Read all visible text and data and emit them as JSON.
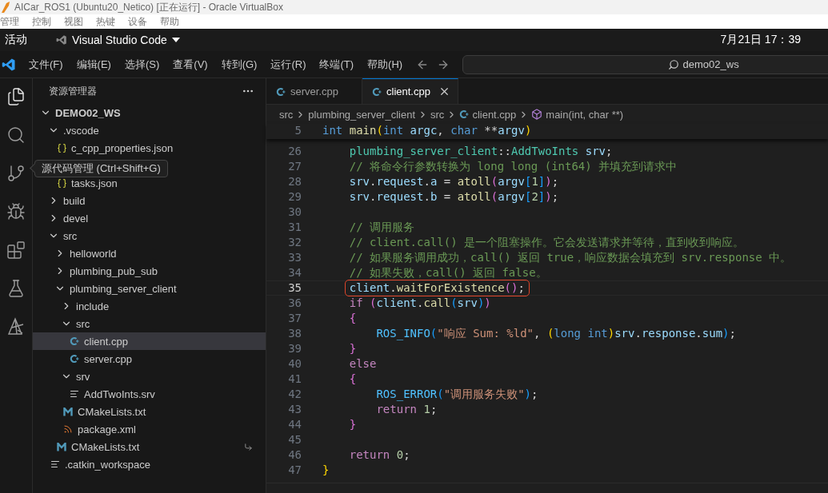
{
  "vbox": {
    "title": "AICar_ROS1 (Ubuntu20_Netico) [正在运行] - Oracle VirtualBox",
    "menu": [
      "管理",
      "控制",
      "视图",
      "热键",
      "设备",
      "帮助"
    ]
  },
  "top_bar": {
    "activities": "活动",
    "app": "Visual Studio Code",
    "clock": "7月21日 17：39"
  },
  "menu": [
    "文件(F)",
    "编辑(E)",
    "选择(S)",
    "查看(V)",
    "转到(G)",
    "运行(R)",
    "终端(T)",
    "帮助(H)"
  ],
  "command_center": {
    "text": "demo02_ws"
  },
  "activity_bar": [
    {
      "kind": "explorer",
      "selected": true
    },
    {
      "kind": "search",
      "selected": false
    },
    {
      "kind": "source-control",
      "selected": false
    },
    {
      "kind": "run-debug",
      "selected": false
    },
    {
      "kind": "extensions",
      "selected": false
    },
    {
      "kind": "testing",
      "selected": false
    },
    {
      "kind": "ros",
      "selected": false
    }
  ],
  "tooltip": {
    "text": "源代码管理 (Ctrl+Shift+G)"
  },
  "sidebar": {
    "title": "资源管理器",
    "root": {
      "name": "DEMO02_WS",
      "expanded": true,
      "children": [
        {
          "name": ".vscode",
          "kind": "folder",
          "expanded": true,
          "selected": false,
          "children": [
            {
              "name": "c_cpp_properties.json",
              "kind": "json",
              "selected": false
            },
            {
              "kind": "covered"
            },
            {
              "name": "tasks.json",
              "kind": "json",
              "selected": false
            }
          ]
        },
        {
          "name": "build",
          "kind": "folder",
          "expanded": false,
          "selected": false
        },
        {
          "name": "devel",
          "kind": "folder",
          "expanded": false,
          "selected": false
        },
        {
          "name": "src",
          "kind": "folder",
          "expanded": true,
          "selected": false,
          "children": [
            {
              "name": "helloworld",
              "kind": "folder",
              "expanded": false,
              "selected": false
            },
            {
              "name": "plumbing_pub_sub",
              "kind": "folder",
              "expanded": false,
              "selected": false
            },
            {
              "name": "plumbing_server_client",
              "kind": "folder",
              "expanded": true,
              "selected": false,
              "children": [
                {
                  "name": "include",
                  "kind": "folder",
                  "expanded": false,
                  "selected": false
                },
                {
                  "name": "src",
                  "kind": "folder",
                  "expanded": true,
                  "selected": false,
                  "children": [
                    {
                      "name": "client.cpp",
                      "kind": "cpp",
                      "selected": true
                    },
                    {
                      "name": "server.cpp",
                      "kind": "cpp",
                      "selected": false
                    }
                  ]
                },
                {
                  "name": "srv",
                  "kind": "folder",
                  "expanded": true,
                  "selected": false,
                  "children": [
                    {
                      "name": "AddTwoInts.srv",
                      "kind": "text",
                      "selected": false
                    }
                  ]
                },
                {
                  "name": "CMakeLists.txt",
                  "kind": "cmake",
                  "selected": false
                },
                {
                  "name": "package.xml",
                  "kind": "xml",
                  "selected": false
                }
              ]
            },
            {
              "name": "CMakeLists.txt",
              "kind": "cmake",
              "selected": false,
              "symlink": true
            }
          ]
        },
        {
          "name": ".catkin_workspace",
          "kind": "text",
          "selected": false
        }
      ]
    }
  },
  "tabs": [
    {
      "label": "server.cpp",
      "selected": false
    },
    {
      "label": "client.cpp",
      "selected": true
    }
  ],
  "breadcrumbs": [
    {
      "label": "src",
      "kind": "folder"
    },
    {
      "label": "plumbing_server_client",
      "kind": "folder"
    },
    {
      "label": "src",
      "kind": "folder"
    },
    {
      "label": "client.cpp",
      "kind": "cpp"
    },
    {
      "label": "main(int, char **)",
      "kind": "method"
    }
  ],
  "sticky_line": {
    "number": "5",
    "tokens": [
      {
        "text": "int",
        "kind": "kw"
      },
      {
        "text": " main",
        "kind": "fn"
      },
      {
        "text": "(",
        "kind": "b1"
      },
      {
        "text": "int",
        "kind": "kw"
      },
      {
        "text": " argc",
        "kind": "var"
      },
      {
        "text": ", ",
        "kind": "p"
      },
      {
        "text": "char",
        "kind": "kw"
      },
      {
        "text": " **",
        "kind": "p"
      },
      {
        "text": "argv",
        "kind": "var"
      },
      {
        "text": ")",
        "kind": "b1"
      }
    ]
  },
  "code_lines": [
    {
      "number": "26",
      "current": false,
      "boxed": false,
      "tokens": [
        {
          "text": "    plumbing_server_client",
          "kind": "type"
        },
        {
          "text": "::",
          "kind": "p"
        },
        {
          "text": "AddTwoInts",
          "kind": "type"
        },
        {
          "text": " srv",
          "kind": "var"
        },
        {
          "text": ";",
          "kind": "p"
        }
      ]
    },
    {
      "number": "27",
      "current": false,
      "boxed": false,
      "tokens": [
        {
          "text": "    // 将命令行参数转换为 long long (int64) 并填充到请求中",
          "kind": "cmt"
        }
      ]
    },
    {
      "number": "28",
      "current": false,
      "boxed": false,
      "tokens": [
        {
          "text": "    srv",
          "kind": "var"
        },
        {
          "text": ".",
          "kind": "p"
        },
        {
          "text": "request",
          "kind": "var"
        },
        {
          "text": ".",
          "kind": "p"
        },
        {
          "text": "a",
          "kind": "var"
        },
        {
          "text": " = ",
          "kind": "p"
        },
        {
          "text": "atoll",
          "kind": "fn"
        },
        {
          "text": "(",
          "kind": "b2"
        },
        {
          "text": "argv",
          "kind": "var"
        },
        {
          "text": "[",
          "kind": "b3"
        },
        {
          "text": "1",
          "kind": "num"
        },
        {
          "text": "]",
          "kind": "b3"
        },
        {
          "text": ")",
          "kind": "b2"
        },
        {
          "text": ";",
          "kind": "p"
        }
      ]
    },
    {
      "number": "29",
      "current": false,
      "boxed": false,
      "tokens": [
        {
          "text": "    srv",
          "kind": "var"
        },
        {
          "text": ".",
          "kind": "p"
        },
        {
          "text": "request",
          "kind": "var"
        },
        {
          "text": ".",
          "kind": "p"
        },
        {
          "text": "b",
          "kind": "var"
        },
        {
          "text": " = ",
          "kind": "p"
        },
        {
          "text": "atoll",
          "kind": "fn"
        },
        {
          "text": "(",
          "kind": "b2"
        },
        {
          "text": "argv",
          "kind": "var"
        },
        {
          "text": "[",
          "kind": "b3"
        },
        {
          "text": "2",
          "kind": "num"
        },
        {
          "text": "]",
          "kind": "b3"
        },
        {
          "text": ")",
          "kind": "b2"
        },
        {
          "text": ";",
          "kind": "p"
        }
      ]
    },
    {
      "number": "30",
      "current": false,
      "boxed": false
    },
    {
      "number": "31",
      "current": false,
      "boxed": false,
      "tokens": [
        {
          "text": "    // 调用服务",
          "kind": "cmt"
        }
      ]
    },
    {
      "number": "32",
      "current": false,
      "boxed": false,
      "tokens": [
        {
          "text": "    // client.call() 是一个阻塞操作。它会发送请求并等待，直到收到响应。",
          "kind": "cmt"
        }
      ]
    },
    {
      "number": "33",
      "current": false,
      "boxed": false,
      "tokens": [
        {
          "text": "    // 如果服务调用成功，call() 返回 true，响应数据会填充到 srv.response 中。",
          "kind": "cmt"
        }
      ]
    },
    {
      "number": "34",
      "current": false,
      "boxed": false,
      "tokens": [
        {
          "text": "    // 如果失败，call() 返回 false。",
          "kind": "cmt"
        }
      ]
    },
    {
      "number": "35",
      "current": true,
      "boxed": true,
      "tokens": [
        {
          "text": "    client",
          "kind": "var"
        },
        {
          "text": ".",
          "kind": "p"
        },
        {
          "text": "waitForExistence",
          "kind": "fn"
        },
        {
          "text": "(",
          "kind": "b2"
        },
        {
          "text": ")",
          "kind": "b2"
        },
        {
          "text": ";",
          "kind": "p"
        }
      ]
    },
    {
      "number": "36",
      "current": false,
      "boxed": false,
      "tokens": [
        {
          "text": "    if",
          "kind": "ctl"
        },
        {
          "text": " (",
          "kind": "b2"
        },
        {
          "text": "client",
          "kind": "var"
        },
        {
          "text": ".",
          "kind": "p"
        },
        {
          "text": "call",
          "kind": "fn"
        },
        {
          "text": "(",
          "kind": "b3"
        },
        {
          "text": "srv",
          "kind": "var"
        },
        {
          "text": ")",
          "kind": "b3"
        },
        {
          "text": ")",
          "kind": "b2"
        }
      ]
    },
    {
      "number": "37",
      "current": false,
      "boxed": false,
      "tokens": [
        {
          "text": "    {",
          "kind": "b2"
        }
      ]
    },
    {
      "number": "38",
      "current": false,
      "boxed": false,
      "tokens": [
        {
          "text": "        ROS_INFO",
          "kind": "macro"
        },
        {
          "text": "(",
          "kind": "b3"
        },
        {
          "text": "\"响应 Sum: %ld\"",
          "kind": "str"
        },
        {
          "text": ", ",
          "kind": "p"
        },
        {
          "text": "(",
          "kind": "b1"
        },
        {
          "text": "long int",
          "kind": "kw"
        },
        {
          "text": ")",
          "kind": "b1"
        },
        {
          "text": "srv",
          "kind": "var"
        },
        {
          "text": ".",
          "kind": "p"
        },
        {
          "text": "response",
          "kind": "var"
        },
        {
          "text": ".",
          "kind": "p"
        },
        {
          "text": "sum",
          "kind": "var"
        },
        {
          "text": ")",
          "kind": "b3"
        },
        {
          "text": ";",
          "kind": "p"
        }
      ]
    },
    {
      "number": "39",
      "current": false,
      "boxed": false,
      "tokens": [
        {
          "text": "    }",
          "kind": "b2"
        }
      ]
    },
    {
      "number": "40",
      "current": false,
      "boxed": false,
      "tokens": [
        {
          "text": "    else",
          "kind": "ctl"
        }
      ]
    },
    {
      "number": "41",
      "current": false,
      "boxed": false,
      "tokens": [
        {
          "text": "    {",
          "kind": "b2"
        }
      ]
    },
    {
      "number": "42",
      "current": false,
      "boxed": false,
      "tokens": [
        {
          "text": "        ROS_ERROR",
          "kind": "macro"
        },
        {
          "text": "(",
          "kind": "b3"
        },
        {
          "text": "\"调用服务失败\"",
          "kind": "str"
        },
        {
          "text": ")",
          "kind": "b3"
        },
        {
          "text": ";",
          "kind": "p"
        }
      ]
    },
    {
      "number": "43",
      "current": false,
      "boxed": false,
      "tokens": [
        {
          "text": "        return",
          "kind": "ctl"
        },
        {
          "text": " 1",
          "kind": "num"
        },
        {
          "text": ";",
          "kind": "p"
        }
      ]
    },
    {
      "number": "44",
      "current": false,
      "boxed": false,
      "tokens": [
        {
          "text": "    }",
          "kind": "b2"
        }
      ]
    },
    {
      "number": "45",
      "current": false,
      "boxed": false
    },
    {
      "number": "46",
      "current": false,
      "boxed": false,
      "tokens": [
        {
          "text": "    return",
          "kind": "ctl"
        },
        {
          "text": " 0",
          "kind": "num"
        },
        {
          "text": ";",
          "kind": "p"
        }
      ]
    },
    {
      "number": "47",
      "current": false,
      "boxed": false,
      "tokens": [
        {
          "text": "}",
          "kind": "b1"
        }
      ]
    }
  ]
}
